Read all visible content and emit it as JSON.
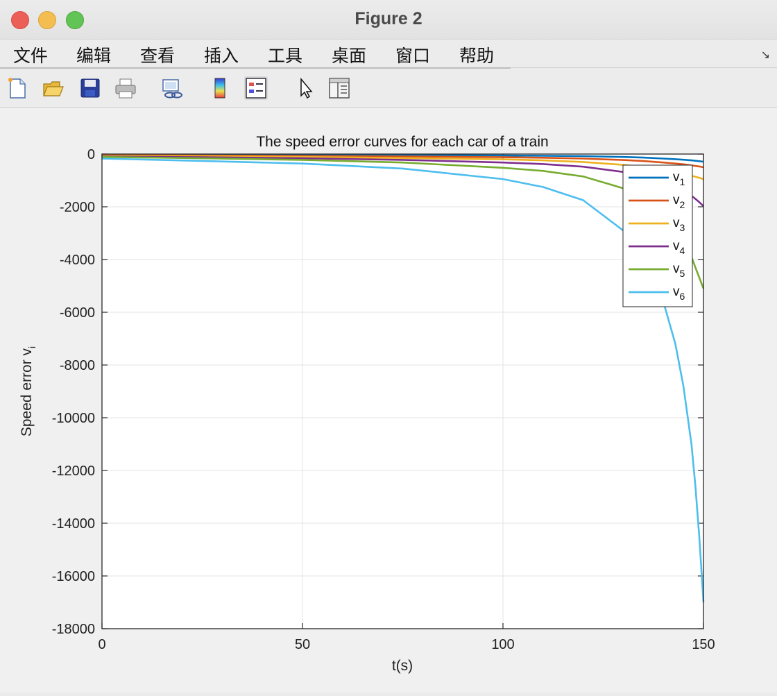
{
  "window": {
    "title": "Figure 2"
  },
  "menu": [
    "文件",
    "编辑",
    "查看",
    "插入",
    "工具",
    "桌面",
    "窗口",
    "帮助"
  ],
  "toolbar": [
    {
      "icon": "new-figure-icon"
    },
    {
      "icon": "open-file-icon"
    },
    {
      "icon": "save-icon"
    },
    {
      "icon": "print-icon"
    },
    {
      "icon": "link-figure-icon"
    },
    {
      "icon": "colorbar-icon"
    },
    {
      "icon": "legend-icon"
    },
    {
      "icon": "pointer-icon"
    },
    {
      "icon": "property-inspector-icon"
    }
  ],
  "chart_data": {
    "type": "line",
    "title": "The speed error curves for each car of a train",
    "xlabel": "t(s)",
    "ylabel": "Speed error v",
    "ylabel_sub": "i",
    "xlim": [
      0,
      150
    ],
    "ylim": [
      -18000,
      0
    ],
    "xticks": [
      0,
      50,
      100,
      150
    ],
    "yticks": [
      0,
      -2000,
      -4000,
      -6000,
      -8000,
      -10000,
      -12000,
      -14000,
      -16000,
      -18000
    ],
    "grid": true,
    "legend_position": "top-right",
    "x": [
      0,
      25,
      50,
      75,
      100,
      110,
      120,
      130,
      135,
      140,
      143,
      145,
      147,
      148,
      149,
      150
    ],
    "series": [
      {
        "name": "v",
        "sub": "1",
        "color": "#0072BD",
        "values": [
          -20,
          -25,
          -30,
          -40,
          -55,
          -65,
          -80,
          -110,
          -135,
          -170,
          -195,
          -215,
          -240,
          -255,
          -270,
          -290
        ]
      },
      {
        "name": "v",
        "sub": "2",
        "color": "#D95319",
        "values": [
          -40,
          -55,
          -70,
          -90,
          -120,
          -140,
          -170,
          -225,
          -265,
          -320,
          -360,
          -390,
          -430,
          -450,
          -470,
          -500
        ]
      },
      {
        "name": "v",
        "sub": "3",
        "color": "#EDB120",
        "values": [
          -60,
          -80,
          -110,
          -150,
          -200,
          -240,
          -300,
          -410,
          -490,
          -600,
          -680,
          -740,
          -820,
          -860,
          -900,
          -950
        ]
      },
      {
        "name": "v",
        "sub": "4",
        "color": "#7E2F8E",
        "values": [
          -90,
          -120,
          -160,
          -220,
          -320,
          -380,
          -480,
          -680,
          -830,
          -1050,
          -1230,
          -1380,
          -1580,
          -1700,
          -1830,
          -1980
        ]
      },
      {
        "name": "v",
        "sub": "5",
        "color": "#77AC30",
        "values": [
          -110,
          -160,
          -220,
          -320,
          -520,
          -640,
          -850,
          -1300,
          -1650,
          -2250,
          -2750,
          -3200,
          -3900,
          -4300,
          -4700,
          -5100
        ]
      },
      {
        "name": "v",
        "sub": "6",
        "color": "#4DBEEE",
        "values": [
          -170,
          -260,
          -360,
          -550,
          -950,
          -1250,
          -1750,
          -2900,
          -3900,
          -5600,
          -7200,
          -8800,
          -11000,
          -12600,
          -14600,
          -17000
        ]
      }
    ]
  }
}
